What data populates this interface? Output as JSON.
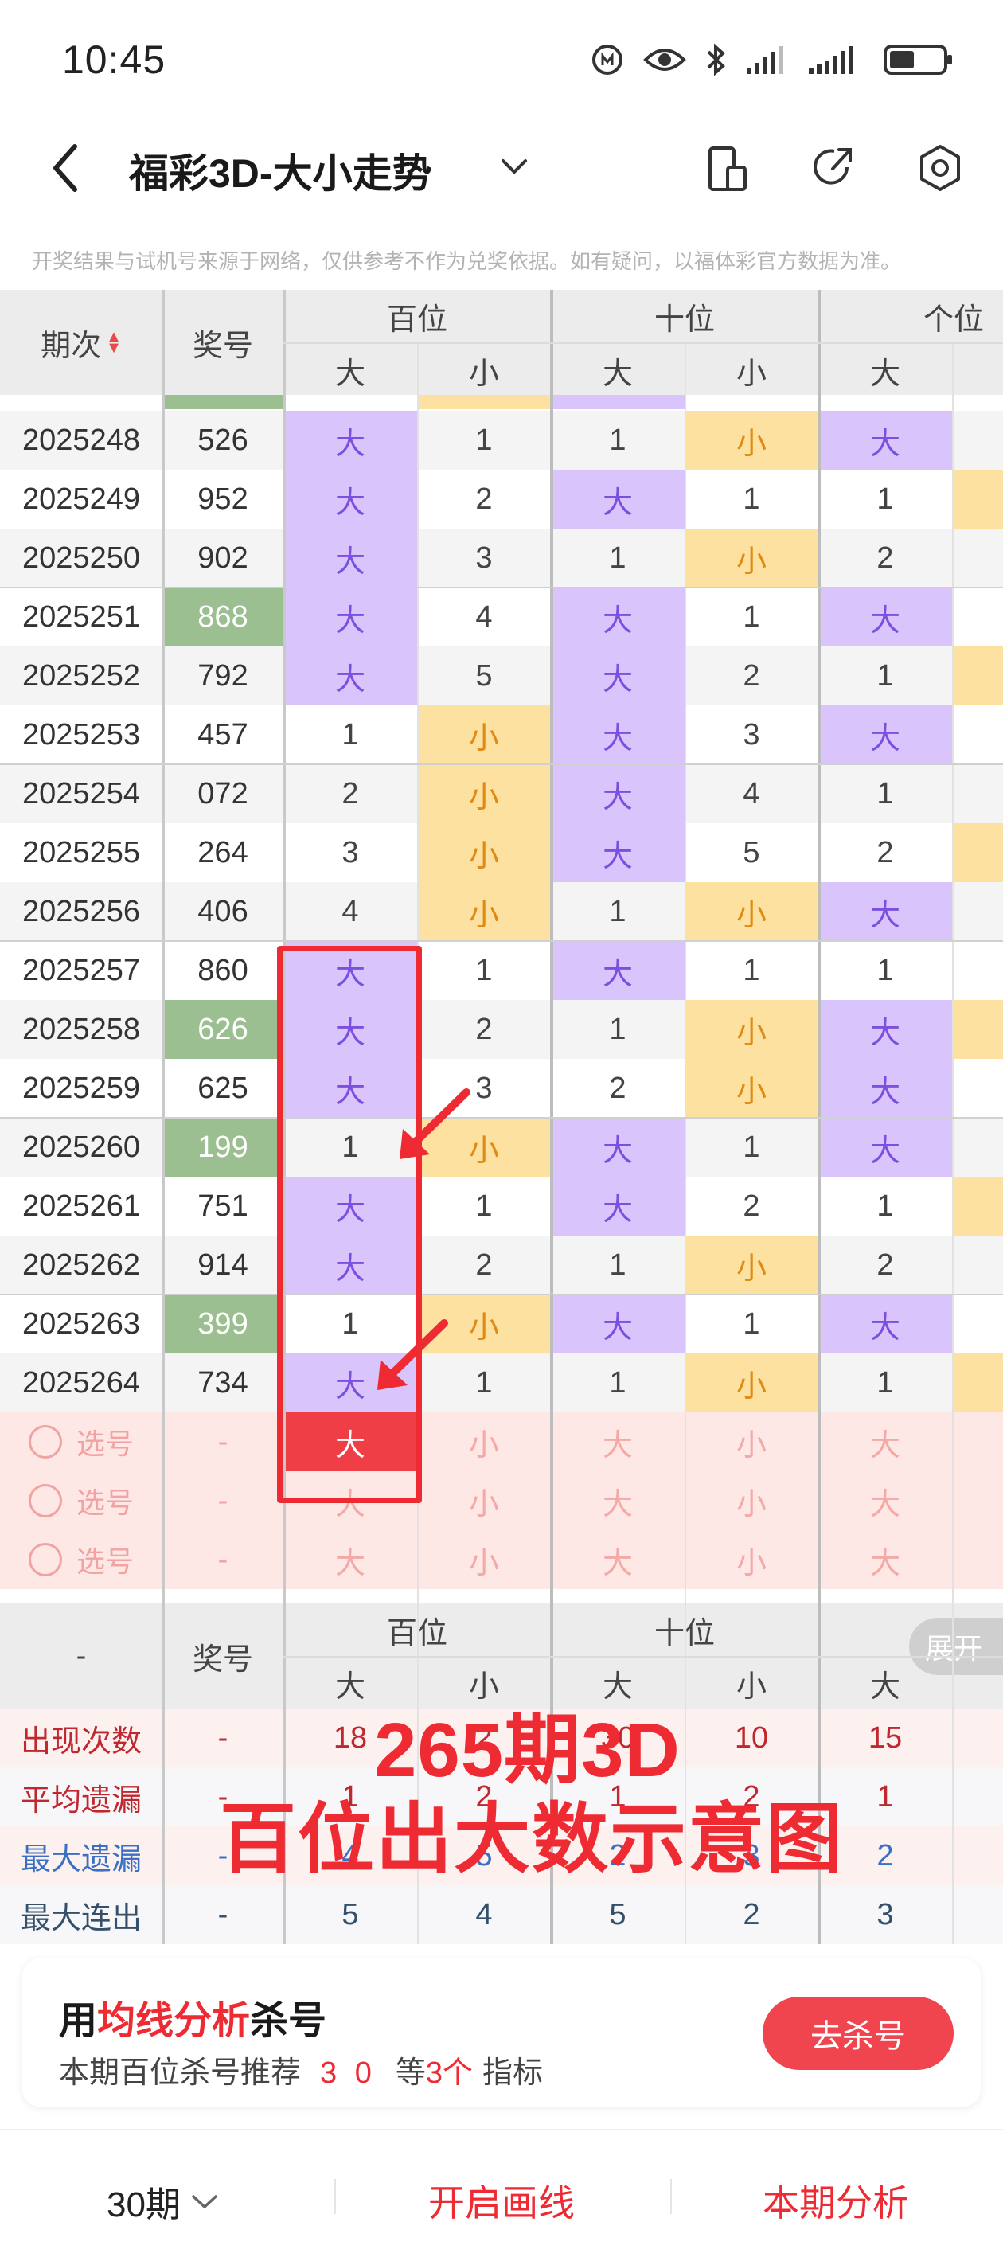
{
  "status": {
    "time": "10:45"
  },
  "nav": {
    "title": "福彩3D-大小走势"
  },
  "disclaimer": "开奖结果与试机号来源于网络，仅供参考不作为兑奖依据。如有疑问，以福体彩官方数据为准。",
  "header": {
    "period": "期次",
    "number": "奖号",
    "groups": [
      "百位",
      "十位",
      "个位"
    ],
    "subs": [
      "大",
      "小",
      "大",
      "小",
      "大"
    ]
  },
  "rows": [
    {
      "p": "2025248",
      "n": "526",
      "g": false,
      "c": [
        "大",
        "1",
        "1",
        "小",
        "大"
      ]
    },
    {
      "p": "2025249",
      "n": "952",
      "g": false,
      "c": [
        "大",
        "2",
        "大",
        "1",
        "1"
      ]
    },
    {
      "p": "2025250",
      "n": "902",
      "g": false,
      "c": [
        "大",
        "3",
        "1",
        "小",
        "2"
      ]
    },
    {
      "p": "2025251",
      "n": "868",
      "g": true,
      "c": [
        "大",
        "4",
        "大",
        "1",
        "大"
      ]
    },
    {
      "p": "2025252",
      "n": "792",
      "g": false,
      "c": [
        "大",
        "5",
        "大",
        "2",
        "1"
      ]
    },
    {
      "p": "2025253",
      "n": "457",
      "g": false,
      "c": [
        "1",
        "小",
        "大",
        "3",
        "大"
      ]
    },
    {
      "p": "2025254",
      "n": "072",
      "g": false,
      "c": [
        "2",
        "小",
        "大",
        "4",
        "1"
      ]
    },
    {
      "p": "2025255",
      "n": "264",
      "g": false,
      "c": [
        "3",
        "小",
        "大",
        "5",
        "2"
      ]
    },
    {
      "p": "2025256",
      "n": "406",
      "g": false,
      "c": [
        "4",
        "小",
        "1",
        "小",
        "大"
      ]
    },
    {
      "p": "2025257",
      "n": "860",
      "g": false,
      "c": [
        "大",
        "1",
        "大",
        "1",
        "1"
      ]
    },
    {
      "p": "2025258",
      "n": "626",
      "g": true,
      "c": [
        "大",
        "2",
        "1",
        "小",
        "大"
      ]
    },
    {
      "p": "2025259",
      "n": "625",
      "g": false,
      "c": [
        "大",
        "3",
        "2",
        "小",
        "大"
      ]
    },
    {
      "p": "2025260",
      "n": "199",
      "g": true,
      "c": [
        "1",
        "小",
        "大",
        "1",
        "大"
      ]
    },
    {
      "p": "2025261",
      "n": "751",
      "g": false,
      "c": [
        "大",
        "1",
        "大",
        "2",
        "1"
      ]
    },
    {
      "p": "2025262",
      "n": "914",
      "g": false,
      "c": [
        "大",
        "2",
        "1",
        "小",
        "2"
      ]
    },
    {
      "p": "2025263",
      "n": "399",
      "g": true,
      "c": [
        "1",
        "小",
        "大",
        "1",
        "大"
      ]
    },
    {
      "p": "2025264",
      "n": "734",
      "g": false,
      "c": [
        "大",
        "1",
        "1",
        "小",
        "1"
      ]
    }
  ],
  "selection": {
    "label": "选号",
    "dash": "-",
    "cells": [
      "大",
      "小",
      "大",
      "小",
      "大"
    ]
  },
  "stats_header": {
    "dash": "-",
    "number": "奖号",
    "groups": [
      "百位",
      "十位"
    ],
    "subs": [
      "大",
      "小",
      "大",
      "小",
      "大"
    ],
    "expand": "展开"
  },
  "stats": [
    {
      "label": "出现次数",
      "dash": "-",
      "vals": [
        "18",
        "2",
        "30",
        "10",
        "15"
      ],
      "color": "#c0282f"
    },
    {
      "label": "平均遗漏",
      "dash": "-",
      "vals": [
        "1",
        "2",
        "1",
        "2",
        "1"
      ],
      "color": "#c0282f"
    },
    {
      "label": "最大遗漏",
      "dash": "-",
      "vals": [
        "4",
        "5",
        "2",
        "3",
        "2"
      ],
      "color": "#3a6fc4"
    },
    {
      "label": "最大连出",
      "dash": "-",
      "vals": [
        "5",
        "4",
        "5",
        "2",
        "3"
      ],
      "color": "#35506b"
    }
  ],
  "overlay": {
    "line1": "265期3D",
    "line2": "百位出大数示意图"
  },
  "promo": {
    "title_pre": "用",
    "title_hl": "均线分析",
    "title_post": "杀号",
    "sub_pre": "本期百位杀号推荐",
    "sub_nums": "3 0",
    "sub_mid": "等",
    "sub_count": "3个",
    "sub_post": "指标",
    "button": "去杀号"
  },
  "bottom": {
    "periods": "30期",
    "draw": "开启画线",
    "analysis": "本期分析"
  },
  "colors": {
    "purple": "#d9c5fb",
    "yellow": "#fde1a0",
    "green": "#9bbf91",
    "red": "#f0454f",
    "pink_bg": "#fde8e6"
  }
}
